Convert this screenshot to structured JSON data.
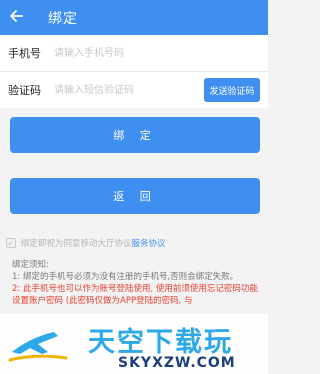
{
  "header": {
    "title": "绑定",
    "back_icon": "arrow-left-icon"
  },
  "phone": {
    "label": "手机号",
    "placeholder": "请输入手机号码",
    "value": ""
  },
  "code": {
    "label": "验证码",
    "placeholder": "请输入短信验证码",
    "value": "",
    "send_label": "发送验证码"
  },
  "buttons": {
    "bind_label": "绑 定",
    "back_label": "返 回"
  },
  "agreement": {
    "text": "绑定即视为同意移动大厅协议",
    "link": "服务协议",
    "checked": true
  },
  "notice": {
    "title": "绑定须知:",
    "item1": "1: 绑定的手机号必须为没有注册的手机号,否则会绑定失败。",
    "item2": "2: 此手机号也可以作为账号登陆使用, 使用前须使用忘记密码功能设置账户密码 (此密码仅做为APP登陆的密码, 与"
  },
  "watermark": {
    "brand": "天空下载玩",
    "site": "SKYXZW.COM"
  },
  "colors": {
    "primary": "#3e8ff0",
    "warning": "#e53f2f",
    "background": "#f3f3f3"
  }
}
